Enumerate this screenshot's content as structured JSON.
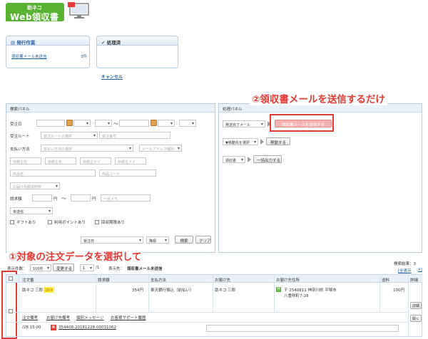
{
  "logo": {
    "line1": "助ネコ",
    "line2": "Web領収書"
  },
  "cards": {
    "issue": {
      "title": "発行作業",
      "item_label": "領収書メール未送信",
      "item_count": "3件"
    },
    "done": {
      "title": "処理済"
    },
    "cancel": "キャンセル"
  },
  "search_panel": {
    "title": "検索パネル",
    "order_date": "受注日",
    "tilde": "〜",
    "order_route": "受注ルート",
    "route_placeholder": "受注ルートの選択",
    "order_number_placeholder": "受注番号",
    "payment": "支払い方法",
    "payment_placeholder": "支払い方法の選択",
    "email_type": "メールアドレス種別",
    "requester_owner": "依頼主控",
    "requester_name": "依頼主名",
    "requester_kana": "依頼主セイ",
    "requester_mail": "依頼主メイ",
    "product_name": "商品名",
    "product_code": "商品コード",
    "delivery_pref": "お届け先都道府県",
    "amount": "請求額",
    "yen1": "円",
    "tilde2": "〜",
    "yen2": "円",
    "memo_placeholder": "一言メモ",
    "status_select": "未送信",
    "gift": "ギフトあり",
    "points": "利用ポイントあり",
    "collection": "回収期限あり",
    "sort_field": "受注日",
    "sort_order": "降順",
    "search_btn": "検索",
    "clear_btn": "クリア"
  },
  "proc_panel": {
    "title": "処理パネル",
    "mail_select": "発送完了メール",
    "send_btn": "領収書メールを送信する",
    "move_select": "▼移動先を選択",
    "move_btn": "移動する",
    "receipt_select": "領収書",
    "batch_btn": "一括出力する"
  },
  "annotations": {
    "step2": "②領収書メールを送信するだけ",
    "step1": "①対象の注文データを選択して"
  },
  "results": {
    "display_count_label": "表示件数：",
    "display_count": "100件",
    "change_btn": "変更する",
    "page": "1",
    "page_total": "/1",
    "showing_label": "表示先：",
    "showing_value": "領収書メール未送信",
    "result_label": "検索結果：3",
    "show_all": "[全表示",
    "close_x": "X]"
  },
  "table": {
    "headers": [
      "注文番",
      "請求額",
      "支払方法",
      "お届け先",
      "お届け先住所",
      "送料",
      "詳細"
    ],
    "row": {
      "customer": "助ネコ 三郎",
      "tag": "ｺﾒﾝﾄ",
      "amount": "354円",
      "payment": "楽天銀行振込（前払い）",
      "recipient": "助ネコ 三郎",
      "ship_tag": "発",
      "address1": "〒 2540811 神奈川県 平塚市",
      "address2": "八重咲町7-28",
      "shipping": "100円",
      "detail_btn": "詳細",
      "open_btn": "開く"
    },
    "links": [
      "注文備考",
      "お届け先備考",
      "個別メッセージ",
      "お客様サポート履歴"
    ],
    "datetime": "/28 15:00",
    "order_id": "354408-20181228-00031062"
  },
  "colors": {
    "accent_red": "#e53935",
    "logo_green": "#58b332",
    "link_blue": "#1f5d9c"
  }
}
